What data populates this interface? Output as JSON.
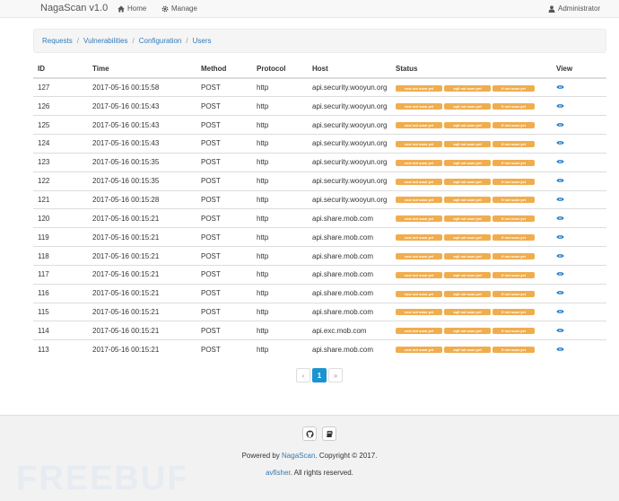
{
  "navbar": {
    "brand": "NagaScan v1.0",
    "home_label": "Home",
    "manage_label": "Manage",
    "user_label": "Administrator"
  },
  "breadcrumb": [
    "Requests",
    "Vulnerabilities",
    "Configuration",
    "Users"
  ],
  "table": {
    "headers": [
      "ID",
      "Time",
      "Method",
      "Protocol",
      "Host",
      "Status",
      "View"
    ],
    "status_badges": [
      "xssi not scan yet",
      "sqli not scan yet",
      "fi not scan yet"
    ],
    "rows": [
      {
        "id": "127",
        "time": "2017-05-16 00:15:58",
        "method": "POST",
        "protocol": "http",
        "host": "api.security.wooyun.org"
      },
      {
        "id": "126",
        "time": "2017-05-16 00:15:43",
        "method": "POST",
        "protocol": "http",
        "host": "api.security.wooyun.org"
      },
      {
        "id": "125",
        "time": "2017-05-16 00:15:43",
        "method": "POST",
        "protocol": "http",
        "host": "api.security.wooyun.org"
      },
      {
        "id": "124",
        "time": "2017-05-16 00:15:43",
        "method": "POST",
        "protocol": "http",
        "host": "api.security.wooyun.org"
      },
      {
        "id": "123",
        "time": "2017-05-16 00:15:35",
        "method": "POST",
        "protocol": "http",
        "host": "api.security.wooyun.org"
      },
      {
        "id": "122",
        "time": "2017-05-16 00:15:35",
        "method": "POST",
        "protocol": "http",
        "host": "api.security.wooyun.org"
      },
      {
        "id": "121",
        "time": "2017-05-16 00:15:28",
        "method": "POST",
        "protocol": "http",
        "host": "api.security.wooyun.org"
      },
      {
        "id": "120",
        "time": "2017-05-16 00:15:21",
        "method": "POST",
        "protocol": "http",
        "host": "api.share.mob.com"
      },
      {
        "id": "119",
        "time": "2017-05-16 00:15:21",
        "method": "POST",
        "protocol": "http",
        "host": "api.share.mob.com"
      },
      {
        "id": "118",
        "time": "2017-05-16 00:15:21",
        "method": "POST",
        "protocol": "http",
        "host": "api.share.mob.com"
      },
      {
        "id": "117",
        "time": "2017-05-16 00:15:21",
        "method": "POST",
        "protocol": "http",
        "host": "api.share.mob.com"
      },
      {
        "id": "116",
        "time": "2017-05-16 00:15:21",
        "method": "POST",
        "protocol": "http",
        "host": "api.share.mob.com"
      },
      {
        "id": "115",
        "time": "2017-05-16 00:15:21",
        "method": "POST",
        "protocol": "http",
        "host": "api.share.mob.com"
      },
      {
        "id": "114",
        "time": "2017-05-16 00:15:21",
        "method": "POST",
        "protocol": "http",
        "host": "api.exc.mob.com"
      },
      {
        "id": "113",
        "time": "2017-05-16 00:15:21",
        "method": "POST",
        "protocol": "http",
        "host": "api.share.mob.com"
      }
    ]
  },
  "pagination": {
    "prev": "‹",
    "current": "1",
    "next": "»"
  },
  "footer": {
    "powered_prefix": "Powered by ",
    "powered_link": "NagaScan",
    "powered_suffix": ". Copyright © 2017.",
    "author_link": "avfisher",
    "author_suffix": ". All rights reserved."
  },
  "watermark": "FREEBUF",
  "icons": {
    "home": "home-icon",
    "manage": "gear-icon",
    "user": "user-icon",
    "view": "eye-icon",
    "github": "github-icon",
    "book": "book-icon"
  },
  "colors": {
    "badge": "#f0ad4e",
    "link": "#337ab7",
    "pager_active": "#1b93d2"
  }
}
